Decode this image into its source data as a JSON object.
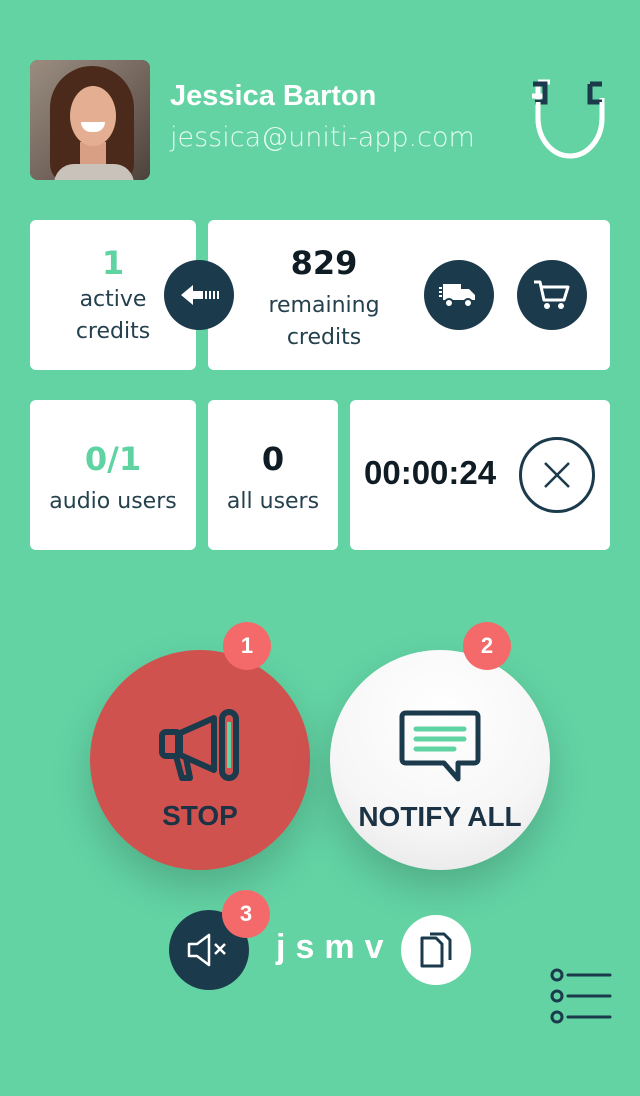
{
  "profile": {
    "name": "Jessica Barton",
    "email": "jessica@uniti-app.com"
  },
  "credits": {
    "active_value": "1",
    "active_label_1": "active",
    "active_label_2": "credits",
    "remaining_value": "829",
    "remaining_label_1": "remaining",
    "remaining_label_2": "credits"
  },
  "stats": {
    "audio_users_value": "0/1",
    "audio_users_label": "audio users",
    "all_users_value": "0",
    "all_users_label": "all users",
    "timer": "00:00:24"
  },
  "actions": {
    "stop_label": "STOP",
    "stop_badge": "1",
    "notify_label": "NOTIFY ALL",
    "notify_badge": "2",
    "mute_badge": "3"
  },
  "session": {
    "code": "jsmv"
  },
  "colors": {
    "background": "#63d3a4",
    "accent_green": "#5fd3a2",
    "dark": "#1b3a4b",
    "stop_red": "#d0524f",
    "badge_red": "#f46a6a"
  },
  "icons": [
    "magnet-icon",
    "arrow-left-icon",
    "delivery-truck-icon",
    "cart-icon",
    "close-icon",
    "megaphone-icon",
    "chat-icon",
    "mute-icon",
    "copy-icon",
    "list-menu-icon"
  ]
}
